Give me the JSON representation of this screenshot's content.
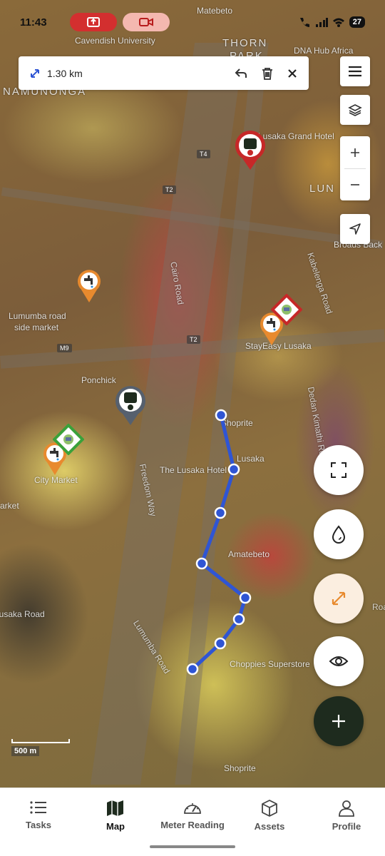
{
  "status_bar": {
    "time": "11:43",
    "battery": "27"
  },
  "measure": {
    "distance": "1.30 km"
  },
  "map_labels": [
    "Cavendish University",
    "Matebeto",
    "THORN",
    "PARK",
    "DNA Hub Africa",
    "NAMUNONGA",
    "Lusaka Grand Hotel",
    "LUN",
    "Lumumba road",
    "side market",
    "StayEasy Lusaka",
    "Ponchick",
    "Shoprite",
    "Lusaka",
    "The Lusaka Hotel",
    "City Market",
    "Amatebeto",
    "Choppies Superstore",
    "Shoprite",
    "Broads Back",
    "Lusaka Road",
    "arket",
    "Lumumba Road",
    "Cairo Road",
    "Freedom Way",
    "Kabelenga Road",
    "Dedan Kimathi Road",
    "T4",
    "T2",
    "T2",
    "M9",
    "Road"
  ],
  "scale": "500 m",
  "nav": {
    "items": [
      {
        "label": "Tasks",
        "icon": "list-icon"
      },
      {
        "label": "Map",
        "icon": "map-icon"
      },
      {
        "label": "Meter Reading",
        "icon": "gauge-icon"
      },
      {
        "label": "Assets",
        "icon": "box-icon"
      },
      {
        "label": "Profile",
        "icon": "person-icon"
      }
    ],
    "active": "Map"
  },
  "colors": {
    "route": "#2f55d4",
    "accent_orange": "#e88a2e",
    "marker_red": "#c62828",
    "marker_grey": "#56606e",
    "marker_green": "#3aa13a",
    "fab_dark": "#1e2b1e"
  }
}
